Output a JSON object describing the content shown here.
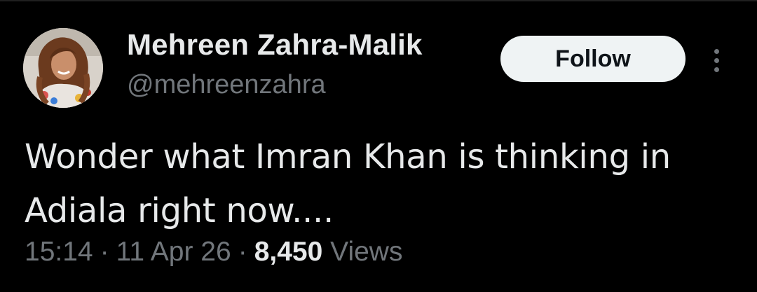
{
  "tweet": {
    "author": {
      "display_name": "Mehreen Zahra-Malik",
      "handle": "@mehreenzahra"
    },
    "follow_label": "Follow",
    "text_lines": [
      "Wonder what Imran Khan is thinking in",
      "Adiala right now...."
    ],
    "time": "15:14",
    "date": "11 Apr 26",
    "separator": "·",
    "views_count": "8,450",
    "views_label": "Views"
  },
  "icons": {
    "avatar": "profile-photo",
    "more": "more-vertical-icon"
  },
  "colors": {
    "background": "#000000",
    "primary_text": "#e7e9ea",
    "secondary_text": "#71767b",
    "follow_button_bg": "#eff3f4",
    "follow_button_text": "#0f1419"
  }
}
